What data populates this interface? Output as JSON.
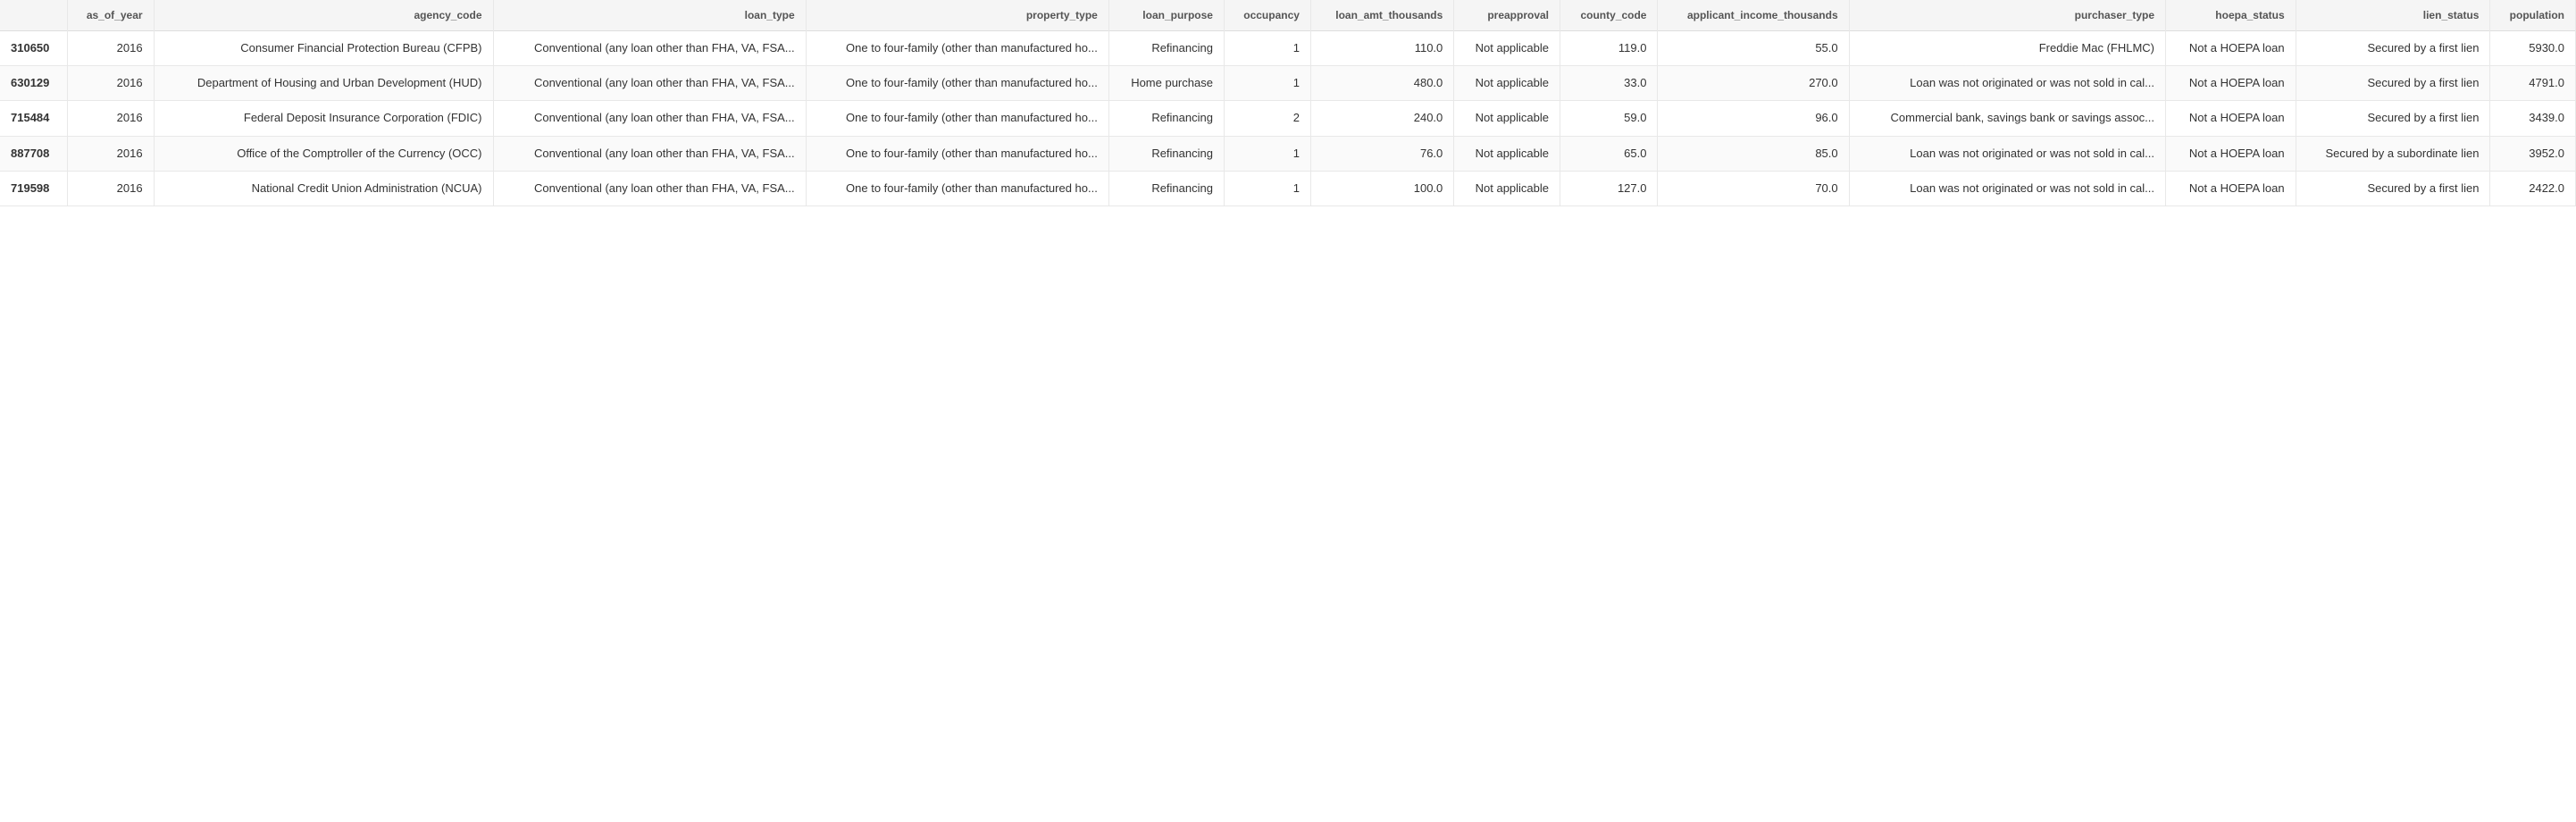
{
  "table": {
    "columns": [
      {
        "key": "row_id",
        "label": ""
      },
      {
        "key": "as_of_year",
        "label": "as_of_year"
      },
      {
        "key": "agency_code",
        "label": "agency_code"
      },
      {
        "key": "loan_type",
        "label": "loan_type"
      },
      {
        "key": "property_type",
        "label": "property_type"
      },
      {
        "key": "loan_purpose",
        "label": "loan_purpose"
      },
      {
        "key": "occupancy",
        "label": "occupancy"
      },
      {
        "key": "loan_amt_thousands",
        "label": "loan_amt_thousands"
      },
      {
        "key": "preapproval",
        "label": "preapproval"
      },
      {
        "key": "county_code",
        "label": "county_code"
      },
      {
        "key": "applicant_income_thousands",
        "label": "applicant_income_thousands"
      },
      {
        "key": "purchaser_type",
        "label": "purchaser_type"
      },
      {
        "key": "hoepa_status",
        "label": "hoepa_status"
      },
      {
        "key": "lien_status",
        "label": "lien_status"
      },
      {
        "key": "population",
        "label": "population"
      }
    ],
    "rows": [
      {
        "row_id": "310650",
        "as_of_year": "2016",
        "agency_code": "Consumer Financial Protection Bureau (CFPB)",
        "loan_type": "Conventional (any loan other than FHA, VA, FSA...",
        "property_type": "One to four-family (other than manufactured ho...",
        "loan_purpose": "Refinancing",
        "occupancy": "1",
        "loan_amt_thousands": "110.0",
        "preapproval": "Not applicable",
        "county_code": "119.0",
        "applicant_income_thousands": "55.0",
        "purchaser_type": "Freddie Mac (FHLMC)",
        "hoepa_status": "Not a HOEPA loan",
        "lien_status": "Secured by a first lien",
        "population": "5930.0"
      },
      {
        "row_id": "630129",
        "as_of_year": "2016",
        "agency_code": "Department of Housing and Urban Development (HUD)",
        "loan_type": "Conventional (any loan other than FHA, VA, FSA...",
        "property_type": "One to four-family (other than manufactured ho...",
        "loan_purpose": "Home purchase",
        "occupancy": "1",
        "loan_amt_thousands": "480.0",
        "preapproval": "Not applicable",
        "county_code": "33.0",
        "applicant_income_thousands": "270.0",
        "purchaser_type": "Loan was not originated or was not sold in cal...",
        "hoepa_status": "Not a HOEPA loan",
        "lien_status": "Secured by a first lien",
        "population": "4791.0"
      },
      {
        "row_id": "715484",
        "as_of_year": "2016",
        "agency_code": "Federal Deposit Insurance Corporation (FDIC)",
        "loan_type": "Conventional (any loan other than FHA, VA, FSA...",
        "property_type": "One to four-family (other than manufactured ho...",
        "loan_purpose": "Refinancing",
        "occupancy": "2",
        "loan_amt_thousands": "240.0",
        "preapproval": "Not applicable",
        "county_code": "59.0",
        "applicant_income_thousands": "96.0",
        "purchaser_type": "Commercial bank, savings bank or savings assoc...",
        "hoepa_status": "Not a HOEPA loan",
        "lien_status": "Secured by a first lien",
        "population": "3439.0"
      },
      {
        "row_id": "887708",
        "as_of_year": "2016",
        "agency_code": "Office of the Comptroller of the Currency (OCC)",
        "loan_type": "Conventional (any loan other than FHA, VA, FSA...",
        "property_type": "One to four-family (other than manufactured ho...",
        "loan_purpose": "Refinancing",
        "occupancy": "1",
        "loan_amt_thousands": "76.0",
        "preapproval": "Not applicable",
        "county_code": "65.0",
        "applicant_income_thousands": "85.0",
        "purchaser_type": "Loan was not originated or was not sold in cal...",
        "hoepa_status": "Not a HOEPA loan",
        "lien_status": "Secured by a subordinate lien",
        "population": "3952.0"
      },
      {
        "row_id": "719598",
        "as_of_year": "2016",
        "agency_code": "National Credit Union Administration (NCUA)",
        "loan_type": "Conventional (any loan other than FHA, VA, FSA...",
        "property_type": "One to four-family (other than manufactured ho...",
        "loan_purpose": "Refinancing",
        "occupancy": "1",
        "loan_amt_thousands": "100.0",
        "preapproval": "Not applicable",
        "county_code": "127.0",
        "applicant_income_thousands": "70.0",
        "purchaser_type": "Loan was not originated or was not sold in cal...",
        "hoepa_status": "Not a HOEPA loan",
        "lien_status": "Secured by a first lien",
        "population": "2422.0"
      }
    ]
  }
}
